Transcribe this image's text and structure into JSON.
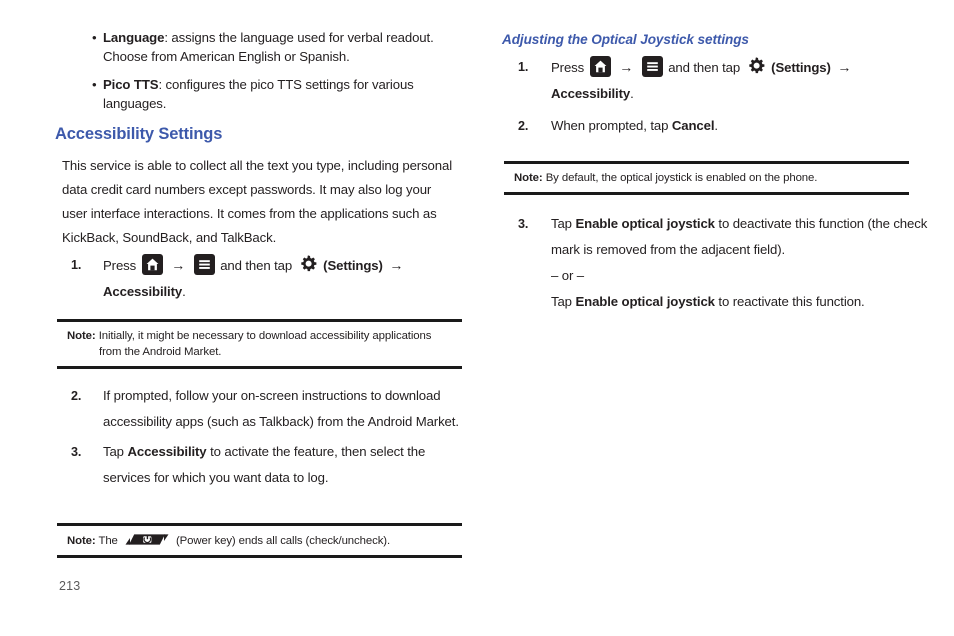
{
  "page": {
    "number": "213",
    "accent_color": "#3d59ab",
    "text_color": "#231f20"
  },
  "left_column": {
    "bullets": [
      {
        "term": "Language",
        "rest": ": assigns the language used for verbal readout. Choose from American English or Spanish."
      },
      {
        "term": "Pico TTS",
        "rest": ": configures the pico TTS settings for various languages."
      }
    ],
    "heading": "Accessibility Settings",
    "intro": "This service is able to collect all the text you type, including personal data credit card numbers except passwords. It may also log your user interface interactions. It comes from the applications such as KickBack, SoundBack, and TalkBack.",
    "step1": {
      "number": "1.",
      "press_label": "Press",
      "home_icon": "home-icon",
      "arrow1": "→",
      "menu_icon": "menu-icon",
      "and_then_tap": "and then tap",
      "gear_icon": "gear-icon",
      "settings_paren": "(Settings)",
      "arrow2": "→",
      "target": "Accessibility",
      "period": "."
    },
    "note1": {
      "label": "Note:",
      "line1": "Initially, it might be necessary to download accessibility applications",
      "line2": "from the Android Market."
    },
    "step2": {
      "number": "2.",
      "text": "If prompted, follow your on-screen instructions to download accessibility apps (such as Talkback) from the Android Market."
    },
    "step3": {
      "number": "3.",
      "before": "Tap ",
      "bold": "Accessibility",
      "after": " to activate the feature, then select the services for which you want data to log."
    },
    "note2": {
      "label": "Note:",
      "before_icon": "The",
      "power_icon": "power-key-icon",
      "after_icon": "(Power key) ends all calls (check/uncheck)."
    }
  },
  "right_column": {
    "heading": "Adjusting the Optical Joystick settings",
    "step1": {
      "number": "1.",
      "press_label": "Press",
      "home_icon": "home-icon",
      "arrow1": "→",
      "menu_icon": "menu-icon",
      "and_then_tap": "and then tap",
      "gear_icon": "gear-icon",
      "settings_paren": "(Settings)",
      "arrow2": "→",
      "target": "Accessibility",
      "period": "."
    },
    "step2": {
      "number": "2.",
      "before": "When prompted, tap ",
      "bold": "Cancel",
      "after": "."
    },
    "note1": {
      "label": "Note:",
      "text": "By default, the optical joystick is enabled on the phone."
    },
    "step3": {
      "number": "3.",
      "before": "Tap ",
      "bold": "Enable optical joystick",
      "after": " to deactivate this function (the check mark is removed from the adjacent field)."
    },
    "or_separator": "– or –",
    "step3_alt": {
      "before": "Tap ",
      "bold": "Enable optical joystick",
      "after": " to reactivate this function."
    }
  }
}
